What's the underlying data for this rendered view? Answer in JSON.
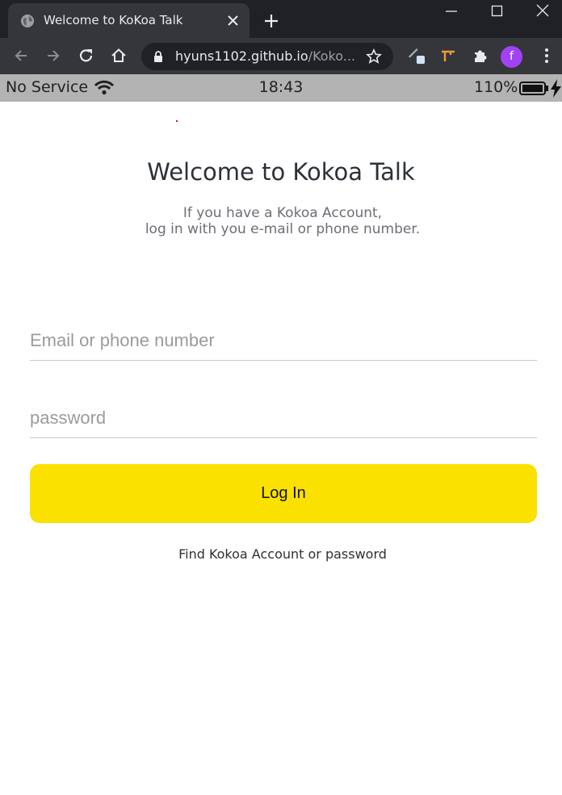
{
  "browser": {
    "tab_title": "Welcome to KoKoa Talk",
    "url_host": "hyuns1102.github.io",
    "url_path": "/Koko...",
    "profile_initial": "f",
    "profile_color": "#a142f4"
  },
  "statusbar": {
    "carrier": "No Service",
    "time": "18:43",
    "battery": "110%"
  },
  "page": {
    "title": "Welcome to Kokoa Talk",
    "intro_line1": "If you have a Kokoa Account,",
    "intro_line2": "log in with you e-mail or phone number."
  },
  "form": {
    "email_placeholder": "Email or phone number",
    "password_placeholder": "password",
    "login_label": "Log In",
    "find_link": "Find Kokoa Account or password"
  },
  "colors": {
    "login_button": "#fae100",
    "status_bar": "#b3b3b3",
    "chrome_dark": "#202124"
  }
}
